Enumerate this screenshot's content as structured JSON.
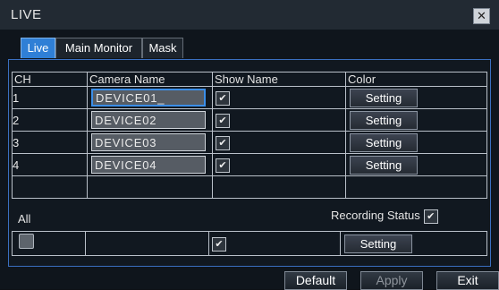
{
  "window": {
    "title": "LIVE",
    "close_icon": "close-icon"
  },
  "tabs": [
    {
      "label": "Live",
      "active": true
    },
    {
      "label": "Main Monitor",
      "active": false
    },
    {
      "label": "Mask",
      "active": false
    }
  ],
  "table": {
    "headers": [
      "CH",
      "Camera Name",
      "Show Name",
      "Color"
    ],
    "rows": [
      {
        "ch": "1",
        "name": "DEVICE01_",
        "show_name": true,
        "color_button": "Setting"
      },
      {
        "ch": "2",
        "name": "DEVICE02",
        "show_name": true,
        "color_button": "Setting"
      },
      {
        "ch": "3",
        "name": "DEVICE03",
        "show_name": true,
        "color_button": "Setting"
      },
      {
        "ch": "4",
        "name": "DEVICE04",
        "show_name": true,
        "color_button": "Setting"
      }
    ]
  },
  "all": {
    "label": "All",
    "recording_status_label": "Recording Status",
    "recording_status_checked": true,
    "all_checked": false,
    "show_name_checked": true,
    "color_button": "Setting"
  },
  "footer": {
    "default_label": "Default",
    "apply_label": "Apply",
    "exit_label": "Exit"
  },
  "colors": {
    "accent": "#2f7fd6",
    "background": "#0f151c",
    "titlebar": "#222a33"
  }
}
